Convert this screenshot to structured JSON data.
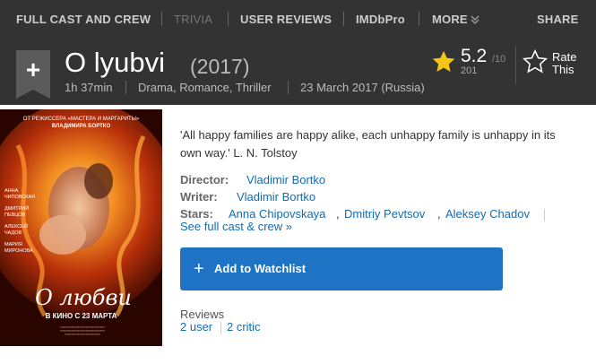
{
  "nav": {
    "items": [
      {
        "label": "FULL CAST AND CREW",
        "disabled": false
      },
      {
        "label": "TRIVIA",
        "disabled": true
      },
      {
        "label": "USER REVIEWS",
        "disabled": false
      },
      {
        "label": "IMDbPro",
        "disabled": false
      },
      {
        "label": "MORE",
        "disabled": false
      }
    ],
    "more_icon": "double-chevron-down-icon",
    "share_label": "SHARE"
  },
  "title": {
    "watchlist_ribbon": "+",
    "name": "O lyubvi",
    "year": "(2017)",
    "runtime": "1h 37min",
    "genres": "Drama, Romance, Thriller",
    "release": "23 March 2017 (Russia)"
  },
  "rating": {
    "value": "5.2",
    "max": "/10",
    "count": "201",
    "rate_label_1": "Rate",
    "rate_label_2": "This",
    "star_color": "#f5c518"
  },
  "poster": {
    "top_line_1": "ОТ РЕЖИССЕРА «МАСТЕРА И МАРГАРИТЫ»",
    "top_line_2": "ВЛАДИМИРА БОРТКО",
    "cast_1a": "АННА",
    "cast_1b": "ЧИПОВСКАЯ",
    "cast_2a": "ДМИТРИЙ",
    "cast_2b": "ПЕВЦОВ",
    "cast_3a": "АЛЕКСЕЙ",
    "cast_3b": "ЧАДОВ",
    "cast_4a": "МАРИЯ",
    "cast_4b": "МИРОНОВА",
    "title": "О любви",
    "release": "В КИНО С 23 МАРТА"
  },
  "summary": "'All happy families are happy alike, each unhappy family is unhappy in its own way.' L. N. Tolstoy",
  "credits": {
    "director_label": "Director:",
    "director": "Vladimir Bortko",
    "writer_label": "Writer:",
    "writer": "Vladimir Bortko",
    "stars_label": "Stars:",
    "stars": [
      "Anna Chipovskaya",
      "Dmitriy Pevtsov",
      "Aleksey Chadov"
    ],
    "full_cast": "See full cast & crew »"
  },
  "watchlist": {
    "icon": "+",
    "label": "Add to Watchlist"
  },
  "reviews": {
    "label": "Reviews",
    "user": "2 user",
    "critic": "2 critic"
  },
  "colors": {
    "header_bg": "#333333",
    "link": "#136cb2",
    "button": "#1f73c5"
  }
}
